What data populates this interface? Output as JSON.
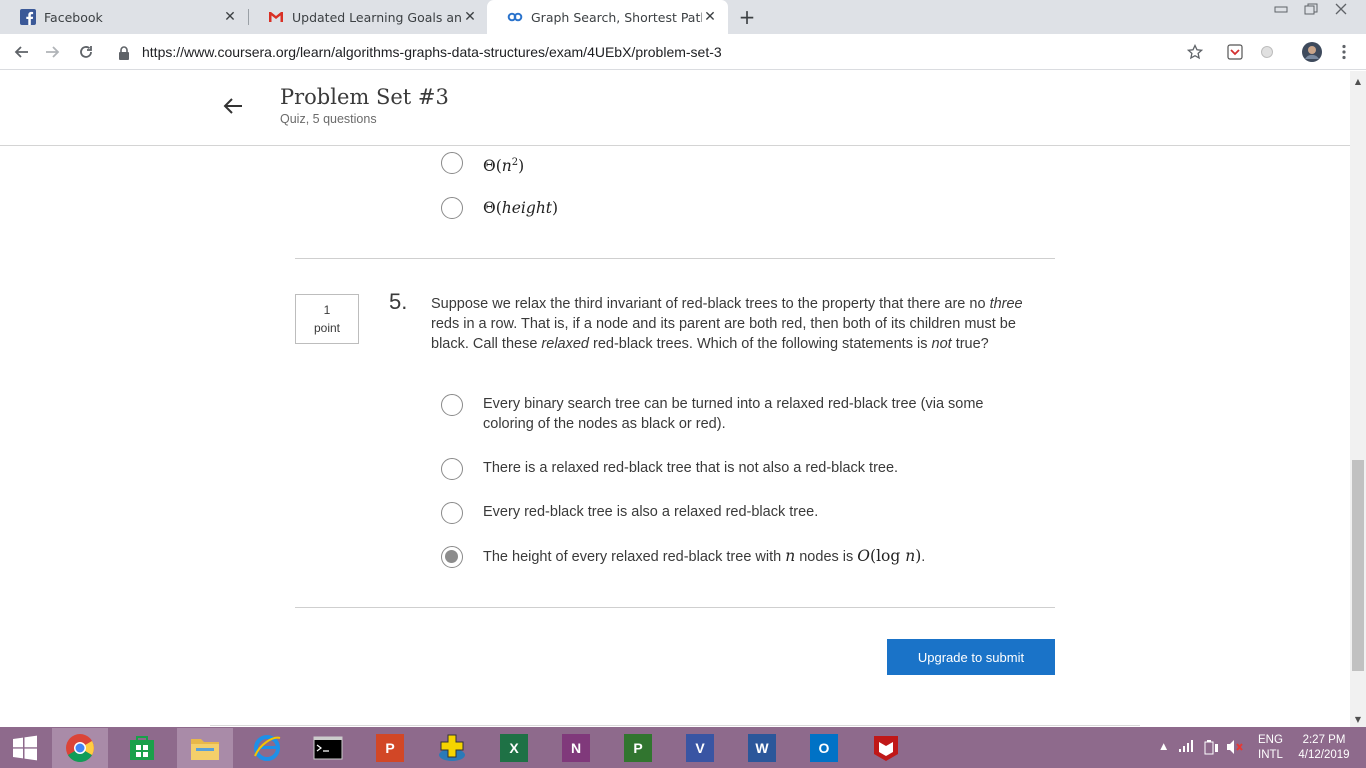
{
  "browser": {
    "tabs": [
      {
        "title": "Facebook",
        "icon": "facebook-icon",
        "active": false
      },
      {
        "title": "Updated Learning Goals and Tim",
        "icon": "gmail-icon",
        "active": false
      },
      {
        "title": "Graph Search, Shortest Paths, and",
        "icon": "coursera-icon",
        "active": true
      }
    ],
    "close_glyph": "✕",
    "new_tab_glyph": "+",
    "url": "https://www.coursera.org/learn/algorithms-graphs-data-structures/exam/4UEbX/problem-set-3"
  },
  "header": {
    "title": "Problem Set #3",
    "subtitle": "Quiz, 5 questions"
  },
  "prev_question": {
    "options": [
      {
        "symbol": "Θ",
        "arg": "n",
        "sup": "2"
      },
      {
        "symbol": "Θ",
        "arg": "height",
        "sup": ""
      }
    ]
  },
  "question": {
    "points_value": "1",
    "points_label": "point",
    "number": "5.",
    "text_parts": {
      "p1": "Suppose we relax the third invariant of red-black trees to the property that there are no ",
      "em1": "three",
      "p2": " reds in a row. That is, if a node and its parent are both red, then both of its children must be black. Call these ",
      "em2": "relaxed",
      "p3": " red-black trees. Which of the following statements is ",
      "em3": "not",
      "p4": " true?"
    },
    "options": [
      {
        "text": "Every binary search tree can be turned into a relaxed red-black tree (via some coloring of the nodes as black or red).",
        "selected": false
      },
      {
        "text": "There is a relaxed red-black tree that is not also a red-black tree.",
        "selected": false
      },
      {
        "text": "Every red-black tree is also a relaxed red-black tree.",
        "selected": false
      },
      {
        "text_before": "The height of every relaxed red-black tree with ",
        "math_n": "n",
        "text_mid": " nodes is ",
        "math_o": "O",
        "math_log": "log",
        "text_after": ".",
        "selected": true
      }
    ]
  },
  "submit": {
    "label": "Upgrade to submit"
  },
  "taskbar": {
    "apps": [
      "windows-start-icon",
      "chrome-icon",
      "store-icon",
      "file-explorer-icon",
      "internet-explorer-icon",
      "cmd-icon",
      "powerpoint-icon",
      "mcafee-plus-icon",
      "excel-icon",
      "onenote-icon",
      "project-icon",
      "visio-icon",
      "word-icon",
      "outlook-icon",
      "mcafee-icon"
    ],
    "lang_top": "ENG",
    "lang_bottom": "INTL",
    "time": "2:27 PM",
    "date": "4/12/2019"
  },
  "colors": {
    "accent": "#1a73c8",
    "taskbar": "#8e6a8c"
  }
}
